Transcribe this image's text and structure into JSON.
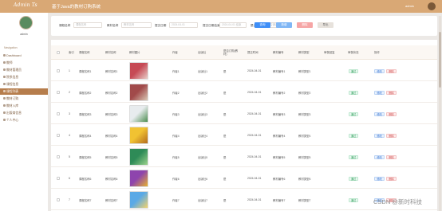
{
  "header": {
    "logo": "Admin Ts",
    "title": "基于Java的教材订购系统",
    "user": "admin"
  },
  "sidebar": {
    "username": "admin",
    "nav_label": "Navigation",
    "items": [
      {
        "label": "Dashboard",
        "active": false
      },
      {
        "label": "教师",
        "active": false
      },
      {
        "label": "教材管理员",
        "active": false
      },
      {
        "label": "院系信息",
        "active": false
      },
      {
        "label": "课程信息",
        "active": false
      },
      {
        "label": "课程列表",
        "active": true
      },
      {
        "label": "教材订购",
        "active": false
      },
      {
        "label": "教材入库",
        "active": false
      },
      {
        "label": "出版商信息",
        "active": false
      },
      {
        "label": "个人中心",
        "active": false
      }
    ]
  },
  "search": {
    "fields": [
      {
        "label": "课程名称",
        "placeholder": "课程名称"
      },
      {
        "label": "教材名称",
        "placeholder": "教材名称"
      },
      {
        "label": "提交日期",
        "placeholder": "2024-04-01"
      },
      {
        "label": "提交日期结束",
        "placeholder": "2024-04-01 结束"
      },
      {
        "label": "是否通过",
        "placeholder": "是否通过"
      }
    ],
    "buttons": {
      "search": "查询",
      "add": "新增",
      "delete": "删除",
      "export": "导出"
    }
  },
  "table": {
    "headers": [
      "",
      "索引",
      "课程名称",
      "教材名称",
      "教材图片",
      "作者",
      "出版社",
      "是否订购(教材)",
      "提交时间",
      "教材编号",
      "教材类型",
      "审核回复",
      "审核状态",
      "操作"
    ],
    "rows": [
      {
        "index": "1",
        "course": "课程名称1",
        "book": "教材名称1",
        "author": "作者1",
        "publisher": "出版社1",
        "ordered": "是",
        "date": "2024-04-01",
        "code": "教材编号1",
        "type": "教材类型1",
        "reply": "",
        "status": "通过",
        "colors": [
          "#c64a55",
          "#e8cfc9"
        ]
      },
      {
        "index": "2",
        "course": "课程名称2",
        "book": "教材名称2",
        "author": "作者2",
        "publisher": "出版社2",
        "ordered": "是",
        "date": "2024-04-01",
        "code": "教材编号2",
        "type": "教材类型2",
        "reply": "",
        "status": "通过",
        "colors": [
          "#a14a4a",
          "#d9c9b6"
        ]
      },
      {
        "index": "3",
        "course": "课程名称3",
        "book": "教材名称3",
        "author": "作者3",
        "publisher": "出版社3",
        "ordered": "是",
        "date": "2024-04-01",
        "code": "教材编号3",
        "type": "教材类型3",
        "reply": "",
        "status": "通过",
        "colors": [
          "#e8ecee",
          "#4b8c4f"
        ]
      },
      {
        "index": "4",
        "course": "课程名称4",
        "book": "教材名称4",
        "author": "作者4",
        "publisher": "出版社4",
        "ordered": "是",
        "date": "2024-04-01",
        "code": "教材编号4",
        "type": "教材类型4",
        "reply": "",
        "status": "通过",
        "colors": [
          "#f1c232",
          "#b36b1d"
        ]
      },
      {
        "index": "5",
        "course": "课程名称5",
        "book": "教材名称5",
        "author": "作者5",
        "publisher": "出版社5",
        "ordered": "是",
        "date": "2024-04-01",
        "code": "教材编号5",
        "type": "教材类型5",
        "reply": "",
        "status": "通过",
        "colors": [
          "#2e8b57",
          "#9bd18b"
        ]
      },
      {
        "index": "6",
        "course": "课程名称6",
        "book": "教材名称6",
        "author": "作者6",
        "publisher": "出版社6",
        "ordered": "是",
        "date": "2024-04-01",
        "code": "教材编号6",
        "type": "教材类型6",
        "reply": "",
        "status": "通过",
        "colors": [
          "#8e44ad",
          "#e8b230"
        ]
      },
      {
        "index": "7",
        "course": "课程名称7",
        "book": "教材名称7",
        "author": "作者7",
        "publisher": "出版社7",
        "ordered": "是",
        "date": "2024-04-01",
        "code": "教材编号7",
        "type": "教材类型7",
        "reply": "",
        "status": "通过",
        "colors": [
          "#5aa9e6",
          "#f3d36b"
        ]
      }
    ],
    "edit_label": "修改",
    "delete_label": "删除"
  },
  "watermark": "CSDN @新时科技",
  "colors": {
    "topbar": "#d9a875",
    "active_nav": "#b67d4c",
    "search_btn": "#3e8ef7",
    "add_btn": "#7fb6f5",
    "delete_btn": "#f6a5a5",
    "export_btn": "#e7e2dc"
  }
}
